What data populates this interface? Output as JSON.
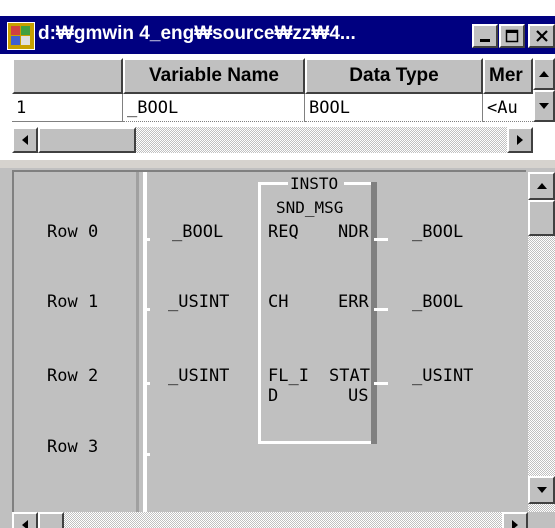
{
  "window": {
    "title": "d:₩gmwin 4_eng₩source₩zz₩4..."
  },
  "grid": {
    "columns": [
      "Variable Name",
      "Data Type",
      "Mer"
    ],
    "row": {
      "index": "1",
      "name": "_BOOL",
      "type": "BOOL",
      "extra": "<Au"
    }
  },
  "ladder": {
    "rows": [
      "Row 0",
      "Row 1",
      "Row 2",
      "Row 3"
    ],
    "block": {
      "name_line1": "INSTO",
      "name_line2": "SND_MSG"
    },
    "inputs": [
      {
        "var": "_BOOL",
        "pin": "REQ"
      },
      {
        "var": "_USINT",
        "pin": "CH"
      },
      {
        "var": "_USINT",
        "pin_line1": "FL_I",
        "pin_line2": "D"
      }
    ],
    "outputs": [
      {
        "pin": "NDR",
        "var": "_BOOL"
      },
      {
        "pin": "ERR",
        "var": "_BOOL"
      },
      {
        "pin_line1": "STAT",
        "pin_line2": "US",
        "var": "_USINT"
      }
    ]
  },
  "colors": {
    "titlebar": "#000080",
    "panel": "#c0c0c0",
    "header_band": "#d6d3ce"
  }
}
